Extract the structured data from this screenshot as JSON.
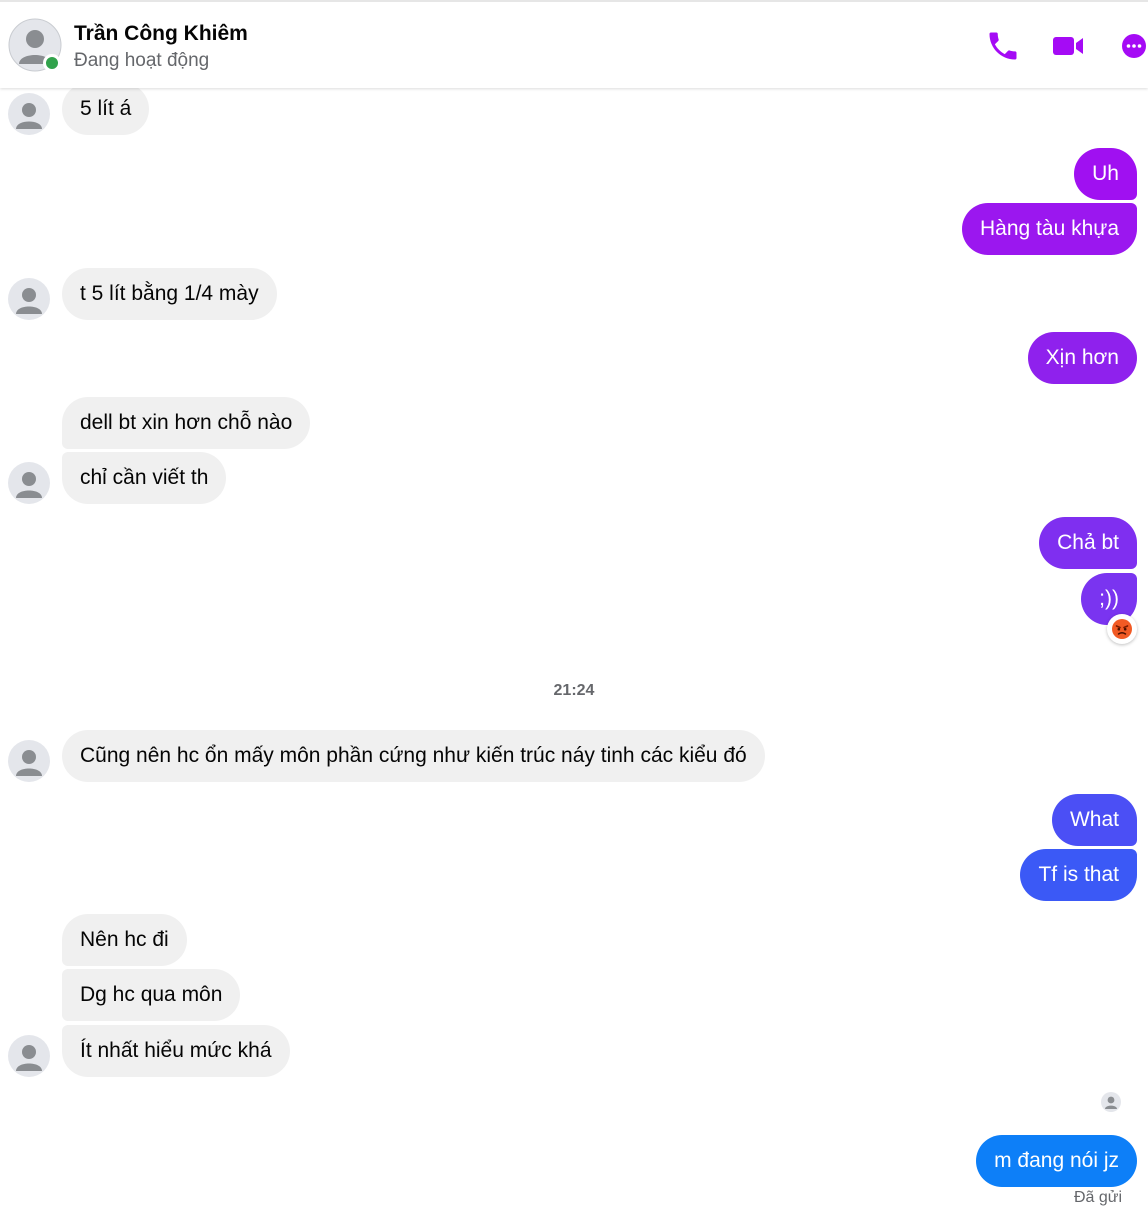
{
  "header": {
    "name": "Trần Công Khiêm",
    "status": "Đang hoạt động",
    "icons": [
      "phone-icon",
      "video-camera-icon",
      "more-options-icon"
    ],
    "accent": "#a50bf5",
    "online_color": "#31a24c"
  },
  "messages": [
    {
      "from": "them",
      "text": "5 lít á"
    },
    {
      "from": "me",
      "text": "Uh",
      "color": "#a010f1"
    },
    {
      "from": "me",
      "text": "Hàng tàu khựa",
      "color": "#9b17ef"
    },
    {
      "from": "them",
      "text": "t 5 lít bằng 1/4 mày"
    },
    {
      "from": "me",
      "text": "Xịn hơn",
      "color": "#8f21ed"
    },
    {
      "from": "them",
      "text": "dell bt xin hơn chỗ nào"
    },
    {
      "from": "them",
      "text": "chỉ cần viết th"
    },
    {
      "from": "me",
      "text": "Chả bt",
      "color": "#7f2ff0"
    },
    {
      "from": "me",
      "text": ";))",
      "color": "#7a34f0",
      "reaction": "angry-face"
    },
    {
      "from": "them",
      "text": "Cũng nên hc ổn mấy môn phần cứng như kiến trúc náy tinh các kiểu đó"
    },
    {
      "from": "me",
      "text": "What",
      "color": "#4b4ff5"
    },
    {
      "from": "me",
      "text": "Tf is that",
      "color": "#3b59f6"
    },
    {
      "from": "them",
      "text": "Nên hc đi"
    },
    {
      "from": "them",
      "text": "Dg hc qua môn"
    },
    {
      "from": "them",
      "text": "Ít nhất hiểu mức khá"
    },
    {
      "from": "me",
      "text": "m đang nói jz",
      "color": "#0d7ff8"
    }
  ],
  "timestamp": "21:24",
  "sent_status": "Đã gửi"
}
